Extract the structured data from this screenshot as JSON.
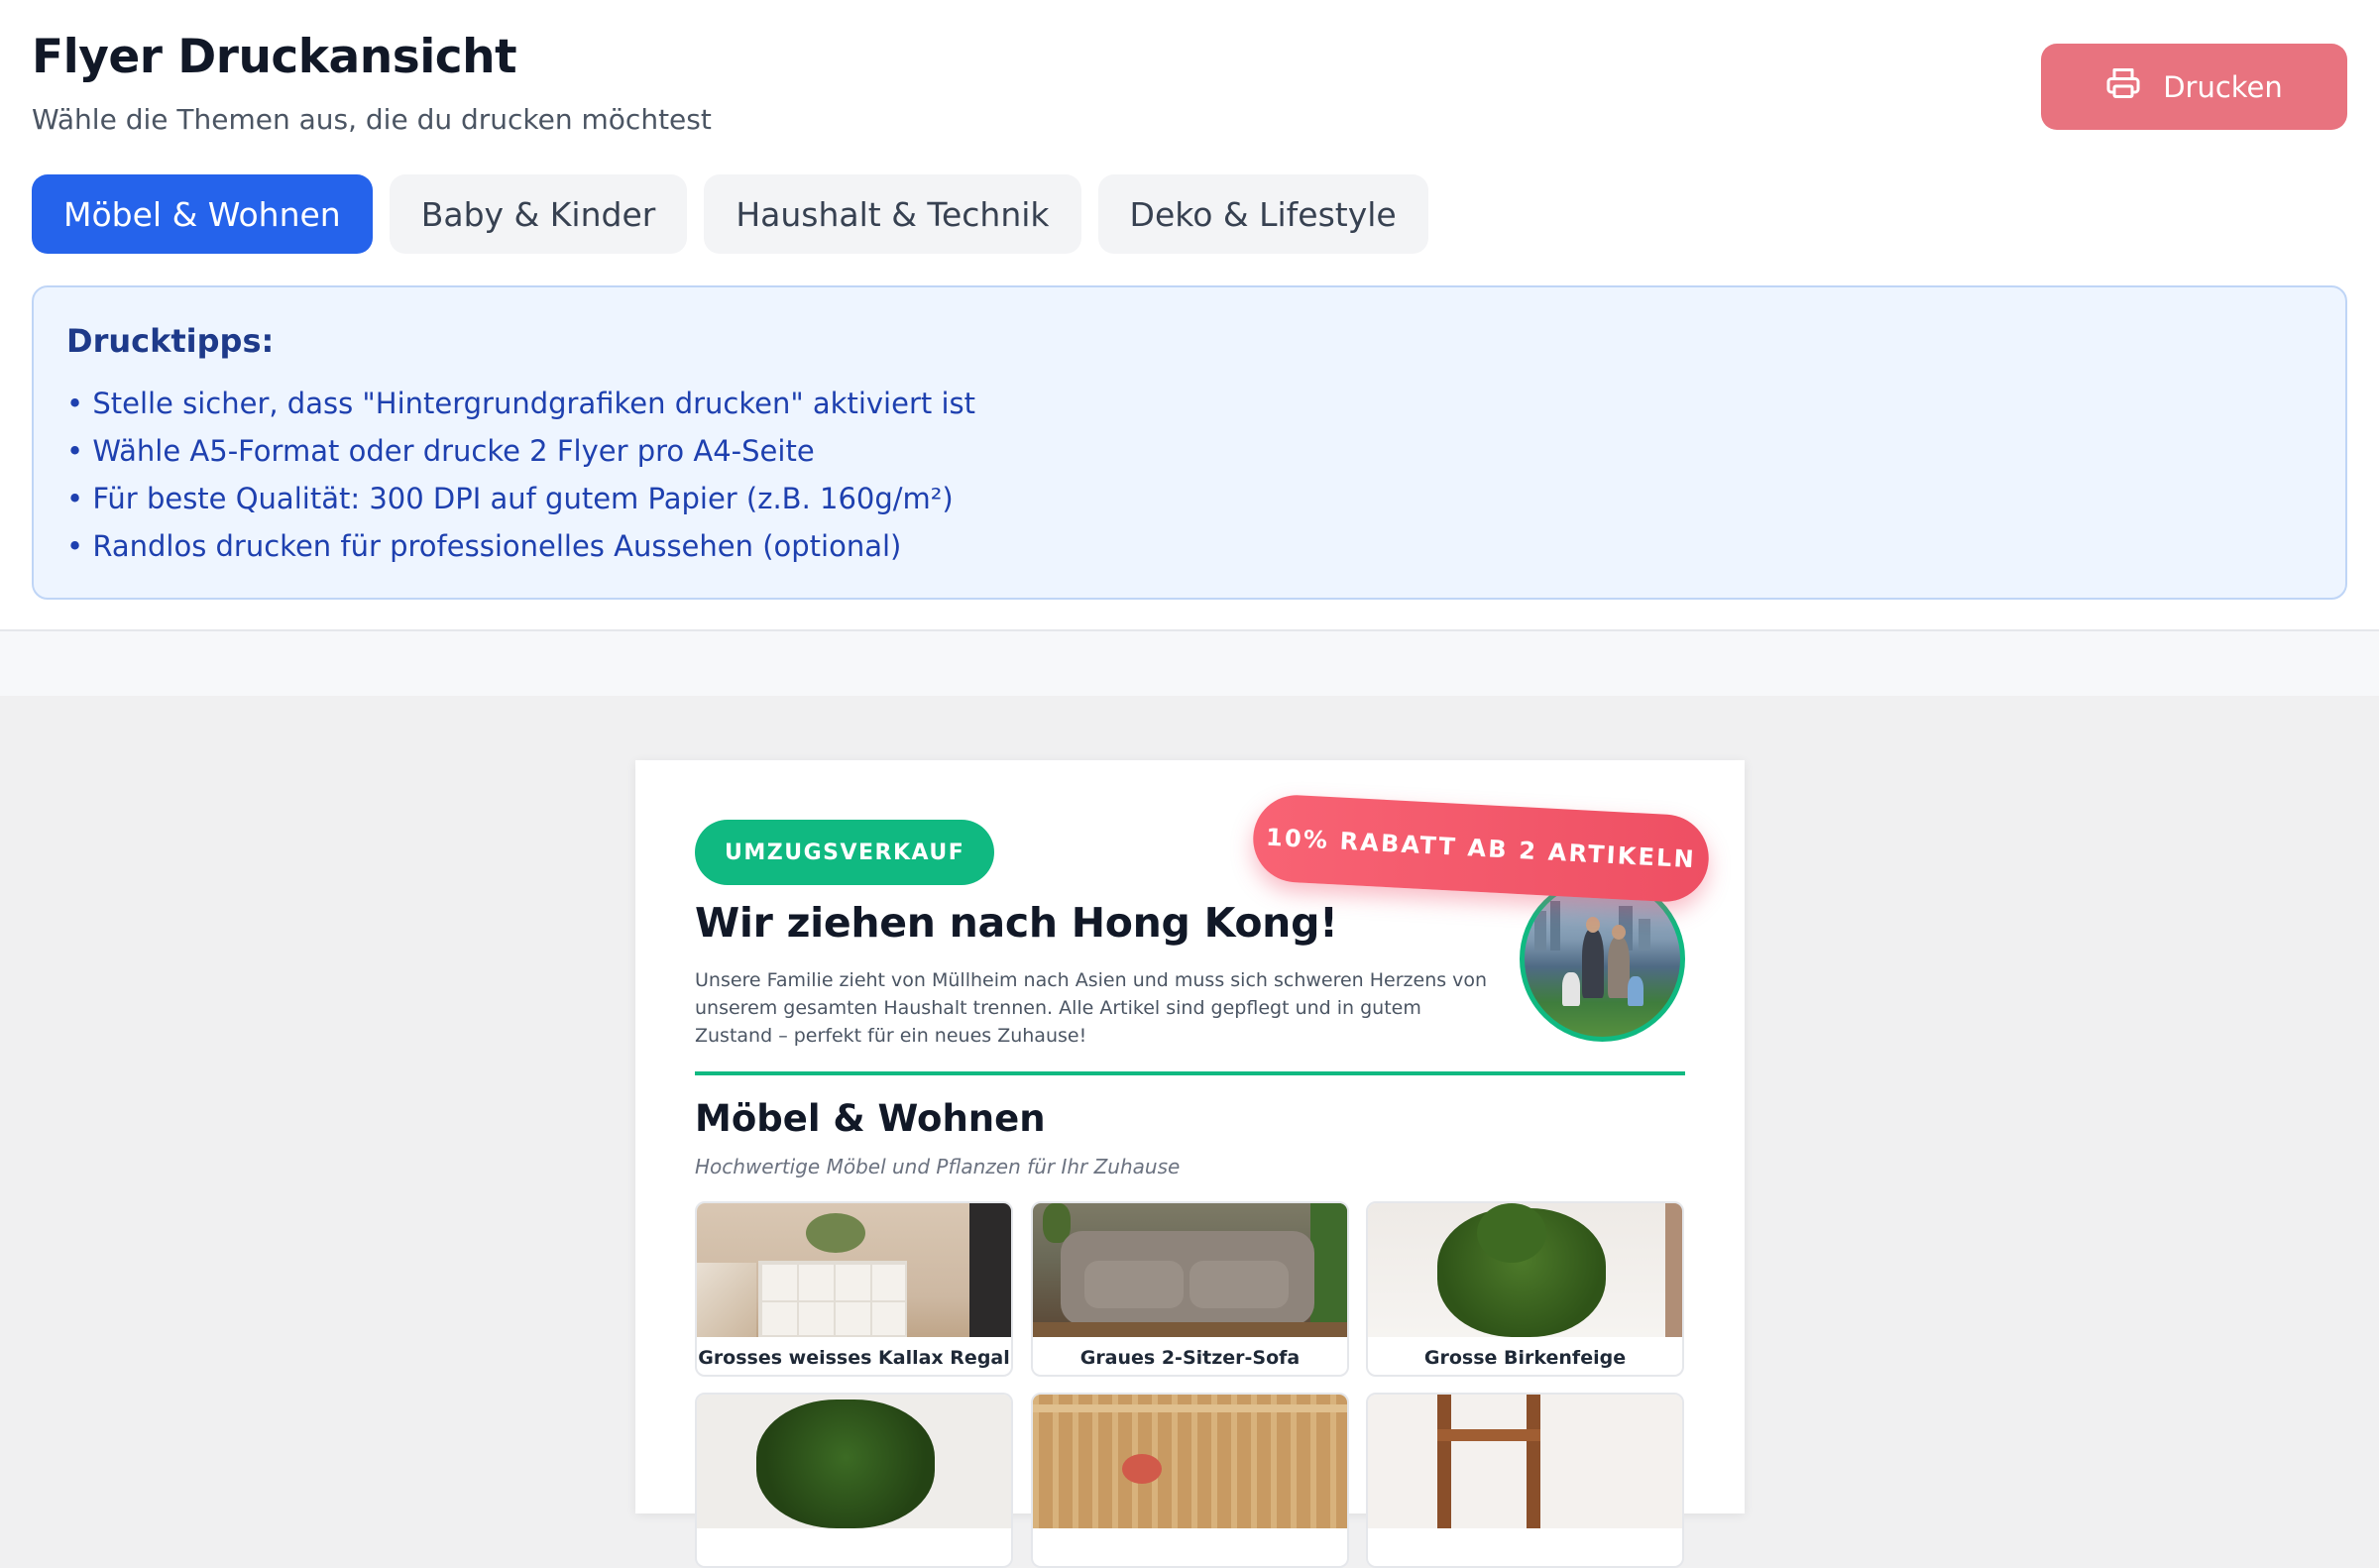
{
  "header": {
    "title": "Flyer Druckansicht",
    "subtitle": "Wähle die Themen aus, die du drucken möchtest",
    "print_label": "Drucken"
  },
  "tabs": [
    {
      "label": "Möbel & Wohnen",
      "active": true
    },
    {
      "label": "Baby & Kinder",
      "active": false
    },
    {
      "label": "Haushalt & Technik",
      "active": false
    },
    {
      "label": "Deko & Lifestyle",
      "active": false
    }
  ],
  "tips": {
    "title": "Drucktipps:",
    "items": [
      "• Stelle sicher, dass \"Hintergrundgrafiken drucken\" aktiviert ist",
      "• Wähle A5-Format oder drucke 2 Flyer pro A4-Seite",
      "• Für beste Qualität: 300 DPI auf gutem Papier (z.B. 160g/m²)",
      "• Randlos drucken für professionelles Aussehen (optional)"
    ]
  },
  "flyer": {
    "badge": "UMZUGSVERKAUF",
    "discount": "10% RABATT AB 2 ARTIKELN",
    "headline": "Wir ziehen nach Hong Kong!",
    "intro": "Unsere Familie zieht von Müllheim nach Asien und muss sich schweren Herzens von unserem gesamten Haushalt trennen. Alle Artikel sind gepflegt und in gutem Zustand – perfekt für ein neues Zuhause!",
    "section_title": "Möbel & Wohnen",
    "section_subtitle": "Hochwertige Möbel und Pflanzen für Ihr Zuhause",
    "products": [
      {
        "name": "Grosses weisses Kallax Regal"
      },
      {
        "name": "Graues 2-Sitzer-Sofa"
      },
      {
        "name": "Grosse Birkenfeige"
      }
    ]
  },
  "colors": {
    "accent_blue": "#2563eb",
    "print_button": "#e8737f",
    "flyer_green": "#10b981",
    "discount_red": "#f0586a"
  }
}
